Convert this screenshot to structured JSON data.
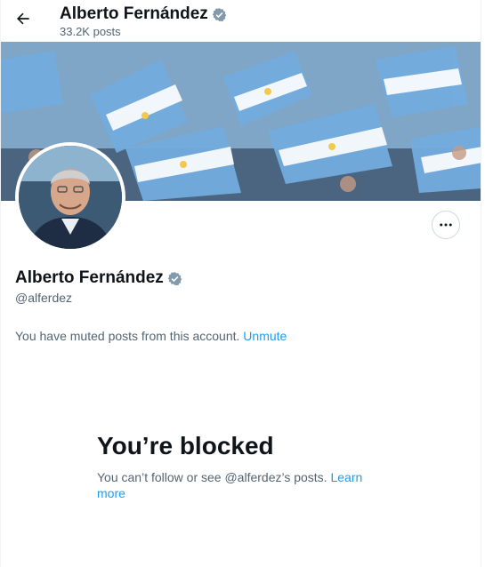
{
  "header": {
    "name": "Alberto Fernández",
    "post_count": "33.2K posts"
  },
  "profile": {
    "name": "Alberto Fernández",
    "handle": "@alferdez"
  },
  "muted_notice": {
    "text": "You have muted posts from this account.",
    "action": "Unmute"
  },
  "blocked": {
    "title": "You’re blocked",
    "text": "You can’t follow or see @alferdez’s posts.",
    "link": "Learn more"
  },
  "icons": {
    "back": "arrow-left-icon",
    "verified": "verified-badge-icon",
    "more": "more-horizontal-icon"
  },
  "colors": {
    "accent": "#1d9bf0",
    "verified_badge": "#829aab",
    "secondary_text": "#536471",
    "banner_flag_blue": "#74acdf"
  }
}
